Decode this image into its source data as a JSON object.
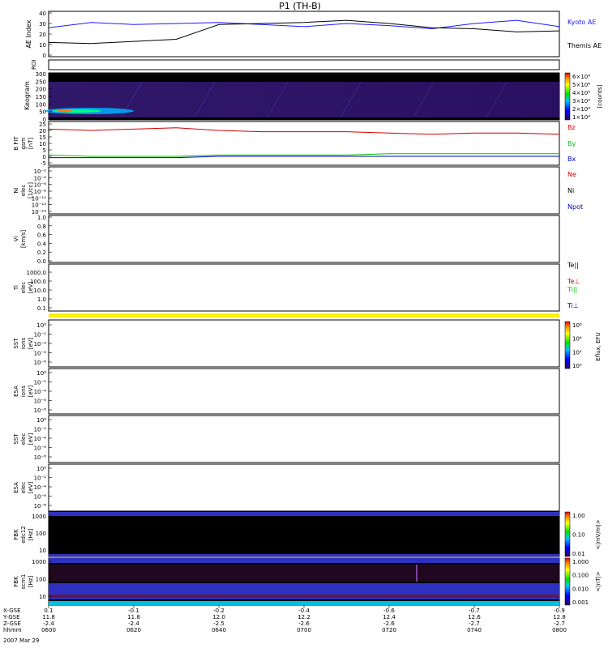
{
  "title": "P1 (TH-B)",
  "panels": {
    "ae": {
      "ylabel": "AE Index",
      "ticks": [
        "40",
        "30",
        "20",
        "10",
        "0"
      ],
      "legend": [
        {
          "label": "Kyoto AE",
          "color": "#1a1aff"
        },
        {
          "label": "Themis AE",
          "color": "#000000"
        }
      ]
    },
    "roi": {
      "ylabel": "ROI"
    },
    "keogram": {
      "ylabel": "Keogram",
      "ticks": [
        "300",
        "250",
        "200",
        "150",
        "100",
        "50",
        "0"
      ],
      "colorbar_ticks": [
        "6×10⁴",
        "5×10⁴",
        "4×10⁴",
        "3×10⁴",
        "2×10⁴",
        "1×10⁴"
      ],
      "colorbar_unit": "[counts]"
    },
    "bfield": {
      "ylabel_lines": [
        "B FIT",
        "gsm",
        "[nT]"
      ],
      "ticks": [
        "25",
        "20",
        "15",
        "10",
        "5",
        "0",
        "-5"
      ],
      "legend": [
        {
          "label": "Bz",
          "color": "#d00000"
        },
        {
          "label": "By",
          "color": "#00c000"
        },
        {
          "label": "Bx",
          "color": "#0000c0"
        }
      ]
    },
    "density": {
      "ylabel_lines": [
        "Ni",
        "elec",
        "[1/cc]"
      ],
      "ticks": [
        "10⁻²",
        "10⁻⁴",
        "10⁻⁶",
        "10⁻⁸",
        "10⁻¹⁰",
        "10⁻¹²",
        "10⁻¹⁴"
      ],
      "legend": [
        {
          "label": "Ne",
          "color": "#d00000"
        },
        {
          "label": "Ni",
          "color": "#000000"
        },
        {
          "label": "Npot",
          "color": "#0000c0"
        }
      ]
    },
    "velocity": {
      "ylabel_lines": [
        "Vi",
        "[km/s]"
      ],
      "ticks": [
        "1.0",
        "0.8",
        "0.6",
        "0.4",
        "0.2",
        "0.0"
      ]
    },
    "temp": {
      "ylabel_lines": [
        "Ti",
        "elec",
        "[eV]"
      ],
      "ticks": [
        "1000.0",
        "100.0",
        "10.0",
        "1.0",
        "0.1"
      ],
      "legend": [
        {
          "label": "Te||",
          "color": "#000000"
        },
        {
          "label": "Te⊥",
          "color": "#d00000"
        },
        {
          "label": "Ti||",
          "color": "#00c000"
        },
        {
          "label": "Ti⊥",
          "color": "#0000c0"
        }
      ]
    },
    "sst_i": {
      "ylabel_lines": [
        "SST",
        "ions",
        "[eV]"
      ],
      "ticks": [
        "10⁶",
        "10⁻²",
        "10⁻⁴",
        "10⁻⁶",
        "10⁻⁸"
      ],
      "colorbar_ticks": [
        "10⁸",
        "10⁴",
        "10²",
        "10⁰"
      ],
      "colorbar_unit": "Eflux, EFU"
    },
    "esa_i": {
      "ylabel_lines": [
        "ESA",
        "ions",
        "[eV]"
      ],
      "ticks": [
        "10⁶",
        "10⁻²",
        "10⁻⁴",
        "10⁻⁶",
        "10⁻⁸"
      ]
    },
    "sst_e": {
      "ylabel_lines": [
        "SST",
        "elec",
        "[eV]"
      ],
      "ticks": [
        "10⁶",
        "10⁻²",
        "10⁻⁴",
        "10⁻⁶",
        "10⁻⁸"
      ]
    },
    "esa_e": {
      "ylabel_lines": [
        "ESA",
        "elec",
        "[eV]"
      ],
      "ticks": [
        "10⁶",
        "10⁻²",
        "10⁻⁴",
        "10⁻⁶",
        "10⁻⁸"
      ]
    },
    "fbk_b": {
      "ylabel_lines": [
        "FBK",
        "edc12",
        "[Hz]"
      ],
      "ticks": [
        "1000",
        "100",
        "10"
      ],
      "colorbar_ticks": [
        "1.00",
        "0.10",
        "0.01"
      ],
      "colorbar_unit": "<|mV/m|>"
    },
    "fbk_e": {
      "ylabel_lines": [
        "FBK",
        "scm1",
        "[Hz]"
      ],
      "ticks": [
        "1000",
        "100",
        "10"
      ],
      "colorbar_ticks": [
        "1.000",
        "0.100",
        "0.010",
        "0.001"
      ],
      "colorbar_unit": "<|nT|>"
    }
  },
  "xaxis": {
    "row_labels": [
      "X-GSE",
      "Y-GSE",
      "Z-GSE",
      "hhmm"
    ],
    "date": "2007 Mar 29",
    "columns": [
      {
        "x": "0.1",
        "y": "11.8",
        "z": "-2.4",
        "t": "0600"
      },
      {
        "x": "-0.1",
        "y": "11.8",
        "z": "-2.4",
        "t": "0620"
      },
      {
        "x": "-0.2",
        "y": "12.0",
        "z": "-2.5",
        "t": "0640"
      },
      {
        "x": "-0.4",
        "y": "12.2",
        "z": "-2.6",
        "t": "0700"
      },
      {
        "x": "-0.6",
        "y": "12.4",
        "z": "-2.6",
        "t": "0720"
      },
      {
        "x": "-0.7",
        "y": "12.6",
        "z": "-2.7",
        "t": "0740"
      },
      {
        "x": "-0.9",
        "y": "12.8",
        "z": "-2.7",
        "t": "0800"
      }
    ]
  },
  "chart_data": {
    "type": "line",
    "title": "P1 (TH-B)",
    "x": [
      "0600",
      "0610",
      "0620",
      "0630",
      "0640",
      "0650",
      "0700",
      "0710",
      "0720",
      "0730",
      "0740",
      "0750",
      "0800"
    ],
    "series": [
      {
        "name": "Kyoto AE",
        "values": [
          26,
          31,
          29,
          30,
          31,
          29,
          27,
          30,
          28,
          25,
          30,
          33,
          27
        ]
      },
      {
        "name": "Themis AE",
        "values": [
          12,
          11,
          13,
          15,
          29,
          30,
          31,
          33,
          30,
          26,
          25,
          22,
          23
        ]
      },
      {
        "name": "Bz",
        "values": [
          21,
          20,
          21,
          22,
          20,
          19,
          19,
          19,
          18,
          17,
          18,
          18,
          17
        ]
      },
      {
        "name": "By",
        "values": [
          1,
          0,
          0,
          0,
          1,
          1,
          1,
          1,
          2,
          2,
          2,
          2,
          2
        ]
      },
      {
        "name": "Bx",
        "values": [
          -1,
          -1,
          -1,
          -1,
          0,
          0,
          0,
          0,
          0,
          0,
          0,
          0,
          0
        ]
      }
    ],
    "ylim_ae": [
      0,
      40
    ],
    "ylim_b": [
      -5,
      25
    ]
  }
}
